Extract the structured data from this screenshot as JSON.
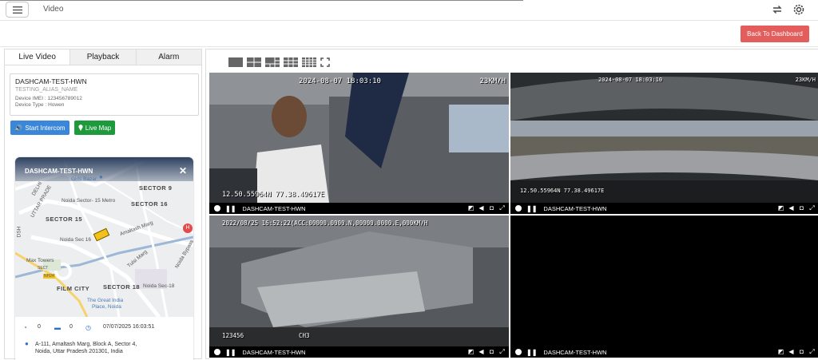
{
  "header": {
    "title": "Video",
    "back_button": "Back To Dashboard"
  },
  "tabs": [
    "Live Video",
    "Playback",
    "Alarm"
  ],
  "device": {
    "name": "DASHCAM-TEST-HWN",
    "alias": "TESTING_ALIAS_NAME",
    "imei": "Device IMEI : 123456789012",
    "type": "Device Type : Howen"
  },
  "buttons": {
    "intercom": "Start Intercom",
    "livemap": "Live Map"
  },
  "map": {
    "title": "DASHCAM-TEST-HWN",
    "labels": {
      "sector9": "SECTOR 9",
      "sector15": "SECTOR 15",
      "sector16": "SECTOR 16",
      "sector18": "SECTOR 18",
      "delhi": "DELHI",
      "uttar": "UTTAR PRADE",
      "girls_bazar": "Girls Bazar",
      "metro": "Noida Sector- 15 Metro",
      "amaltash": "Amaltash Marg",
      "tulsi": "Tulsi Marg",
      "noida_sec16": "Noida Sec 16",
      "noida_bypass": "Noida Bypass",
      "max_towers": "Max Towers",
      "film_city": "FILM CITY",
      "noida_sec18": "Noida Sec-18",
      "great_india_1": "The Great India",
      "great_india_2": "Place, Noida",
      "sect_upper": "SECT",
      "nh": "NH24",
      "dsh": "DSH"
    }
  },
  "status": {
    "speed": "0",
    "count": "0",
    "datetime": "07/07/2025 16:03:51"
  },
  "address": {
    "line1": "A-111, Amaltash Marg, Block A, Sector 4,",
    "line2": "Noida, Uttar Pradesh 201301, India"
  },
  "videos": [
    {
      "name": "DASHCAM-TEST-HWN",
      "timestamp": "2024-08-07 18:03:10",
      "speed": "23KM/H",
      "gps": "12.50.55964N 77.38.49617E"
    },
    {
      "name": "DASHCAM-TEST-HWN",
      "timestamp": "2024-08-07 18:03:10",
      "speed": "23KM/H",
      "gps": "12.50.55964N 77.38.49617E"
    },
    {
      "name": "DASHCAM-TEST-HWN",
      "timestamp": "2022/08/25 16:52:22(ACC:00000.0000.N,00000.0000.E,000KM/H",
      "bottom_left": "123456",
      "channel": "CH3"
    },
    {
      "name": "DASHCAM-TEST-HWN"
    }
  ]
}
